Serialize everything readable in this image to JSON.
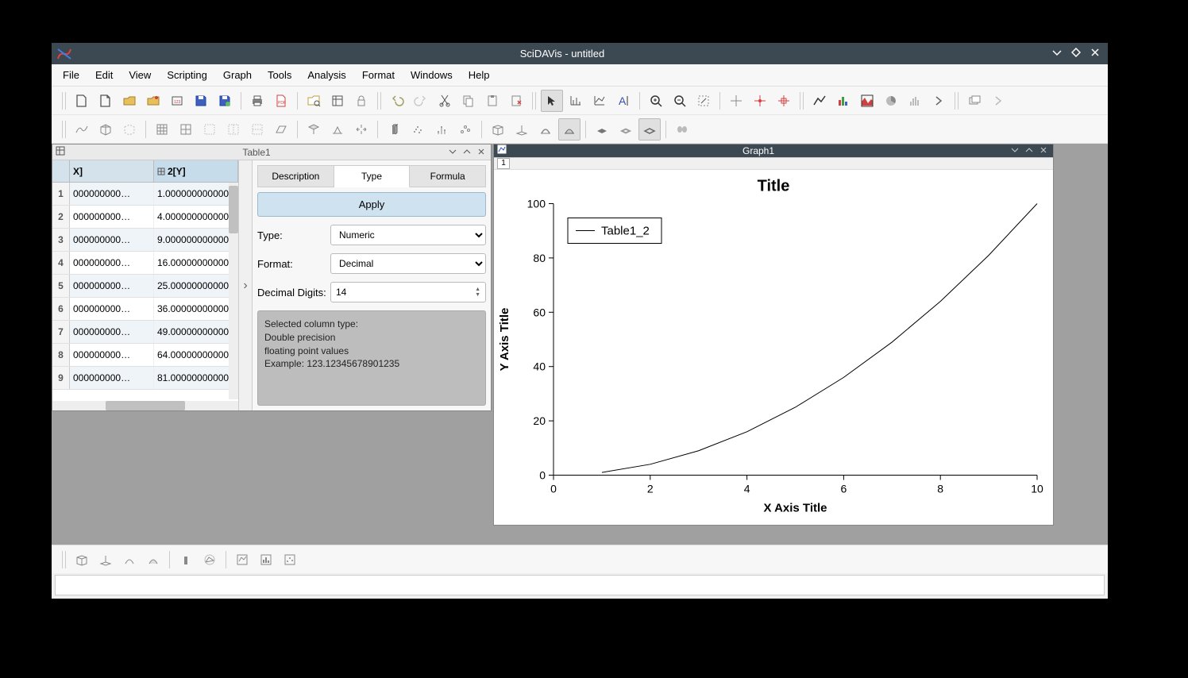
{
  "window": {
    "title": "SciDAVis - untitled"
  },
  "menus": [
    "File",
    "Edit",
    "View",
    "Scripting",
    "Graph",
    "Tools",
    "Analysis",
    "Format",
    "Windows",
    "Help"
  ],
  "table_window": {
    "title": "Table1",
    "col_headers": [
      "X]",
      "2[Y]"
    ],
    "rows": [
      {
        "n": "1",
        "x": "000000000…",
        "y": "1.0000000000000…"
      },
      {
        "n": "2",
        "x": "000000000…",
        "y": "4.0000000000000…"
      },
      {
        "n": "3",
        "x": "000000000…",
        "y": "9.0000000000000…"
      },
      {
        "n": "4",
        "x": "000000000…",
        "y": "16.00000000000…"
      },
      {
        "n": "5",
        "x": "000000000…",
        "y": "25.00000000000…"
      },
      {
        "n": "6",
        "x": "000000000…",
        "y": "36.00000000000…"
      },
      {
        "n": "7",
        "x": "000000000…",
        "y": "49.00000000000…"
      },
      {
        "n": "8",
        "x": "000000000…",
        "y": "64.00000000000…"
      },
      {
        "n": "9",
        "x": "000000000…",
        "y": "81.00000000000…"
      }
    ]
  },
  "side_panel": {
    "tabs": [
      "Description",
      "Type",
      "Formula"
    ],
    "active_tab": 1,
    "apply": "Apply",
    "type_label": "Type:",
    "type_value": "Numeric",
    "format_label": "Format:",
    "format_value": "Decimal",
    "digits_label": "Decimal Digits:",
    "digits_value": "14",
    "info_l1": "Selected column type:",
    "info_l2": "Double precision",
    "info_l3": "floating point values",
    "info_l4": "Example: 123.12345678901235"
  },
  "graph_window": {
    "title": "Graph1",
    "layer": "1"
  },
  "chart_data": {
    "type": "line",
    "title": "Title",
    "xlabel": "X Axis Title",
    "ylabel": "Y Axis Title",
    "legend": "Table1_2",
    "x_ticks": [
      0,
      2,
      4,
      6,
      8,
      10
    ],
    "y_ticks": [
      0,
      20,
      40,
      60,
      80,
      100
    ],
    "xlim": [
      0,
      10
    ],
    "ylim": [
      0,
      100
    ],
    "series": [
      {
        "name": "Table1_2",
        "x": [
          1,
          2,
          3,
          4,
          5,
          6,
          7,
          8,
          9,
          10
        ],
        "values": [
          1,
          4,
          9,
          16,
          25,
          36,
          49,
          64,
          81,
          100
        ]
      }
    ]
  }
}
